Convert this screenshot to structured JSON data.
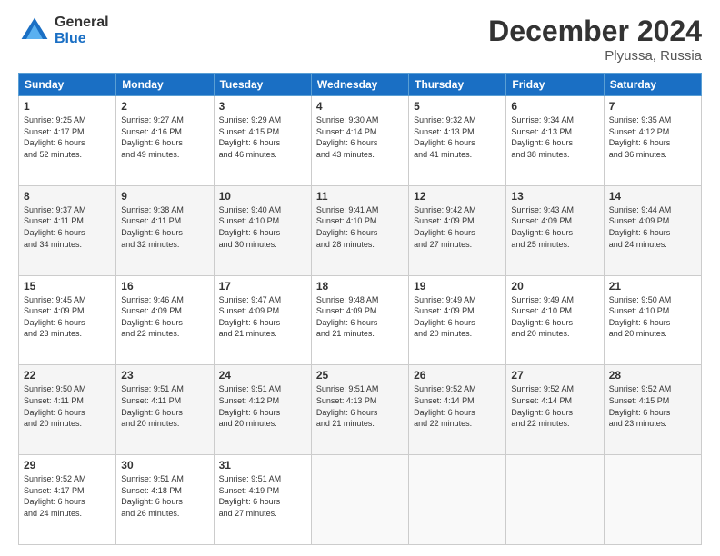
{
  "header": {
    "logo_line1": "General",
    "logo_line2": "Blue",
    "month": "December 2024",
    "location": "Plyussa, Russia"
  },
  "weekdays": [
    "Sunday",
    "Monday",
    "Tuesday",
    "Wednesday",
    "Thursday",
    "Friday",
    "Saturday"
  ],
  "weeks": [
    [
      {
        "day": "1",
        "info": "Sunrise: 9:25 AM\nSunset: 4:17 PM\nDaylight: 6 hours\nand 52 minutes."
      },
      {
        "day": "2",
        "info": "Sunrise: 9:27 AM\nSunset: 4:16 PM\nDaylight: 6 hours\nand 49 minutes."
      },
      {
        "day": "3",
        "info": "Sunrise: 9:29 AM\nSunset: 4:15 PM\nDaylight: 6 hours\nand 46 minutes."
      },
      {
        "day": "4",
        "info": "Sunrise: 9:30 AM\nSunset: 4:14 PM\nDaylight: 6 hours\nand 43 minutes."
      },
      {
        "day": "5",
        "info": "Sunrise: 9:32 AM\nSunset: 4:13 PM\nDaylight: 6 hours\nand 41 minutes."
      },
      {
        "day": "6",
        "info": "Sunrise: 9:34 AM\nSunset: 4:13 PM\nDaylight: 6 hours\nand 38 minutes."
      },
      {
        "day": "7",
        "info": "Sunrise: 9:35 AM\nSunset: 4:12 PM\nDaylight: 6 hours\nand 36 minutes."
      }
    ],
    [
      {
        "day": "8",
        "info": "Sunrise: 9:37 AM\nSunset: 4:11 PM\nDaylight: 6 hours\nand 34 minutes."
      },
      {
        "day": "9",
        "info": "Sunrise: 9:38 AM\nSunset: 4:11 PM\nDaylight: 6 hours\nand 32 minutes."
      },
      {
        "day": "10",
        "info": "Sunrise: 9:40 AM\nSunset: 4:10 PM\nDaylight: 6 hours\nand 30 minutes."
      },
      {
        "day": "11",
        "info": "Sunrise: 9:41 AM\nSunset: 4:10 PM\nDaylight: 6 hours\nand 28 minutes."
      },
      {
        "day": "12",
        "info": "Sunrise: 9:42 AM\nSunset: 4:09 PM\nDaylight: 6 hours\nand 27 minutes."
      },
      {
        "day": "13",
        "info": "Sunrise: 9:43 AM\nSunset: 4:09 PM\nDaylight: 6 hours\nand 25 minutes."
      },
      {
        "day": "14",
        "info": "Sunrise: 9:44 AM\nSunset: 4:09 PM\nDaylight: 6 hours\nand 24 minutes."
      }
    ],
    [
      {
        "day": "15",
        "info": "Sunrise: 9:45 AM\nSunset: 4:09 PM\nDaylight: 6 hours\nand 23 minutes."
      },
      {
        "day": "16",
        "info": "Sunrise: 9:46 AM\nSunset: 4:09 PM\nDaylight: 6 hours\nand 22 minutes."
      },
      {
        "day": "17",
        "info": "Sunrise: 9:47 AM\nSunset: 4:09 PM\nDaylight: 6 hours\nand 21 minutes."
      },
      {
        "day": "18",
        "info": "Sunrise: 9:48 AM\nSunset: 4:09 PM\nDaylight: 6 hours\nand 21 minutes."
      },
      {
        "day": "19",
        "info": "Sunrise: 9:49 AM\nSunset: 4:09 PM\nDaylight: 6 hours\nand 20 minutes."
      },
      {
        "day": "20",
        "info": "Sunrise: 9:49 AM\nSunset: 4:10 PM\nDaylight: 6 hours\nand 20 minutes."
      },
      {
        "day": "21",
        "info": "Sunrise: 9:50 AM\nSunset: 4:10 PM\nDaylight: 6 hours\nand 20 minutes."
      }
    ],
    [
      {
        "day": "22",
        "info": "Sunrise: 9:50 AM\nSunset: 4:11 PM\nDaylight: 6 hours\nand 20 minutes."
      },
      {
        "day": "23",
        "info": "Sunrise: 9:51 AM\nSunset: 4:11 PM\nDaylight: 6 hours\nand 20 minutes."
      },
      {
        "day": "24",
        "info": "Sunrise: 9:51 AM\nSunset: 4:12 PM\nDaylight: 6 hours\nand 20 minutes."
      },
      {
        "day": "25",
        "info": "Sunrise: 9:51 AM\nSunset: 4:13 PM\nDaylight: 6 hours\nand 21 minutes."
      },
      {
        "day": "26",
        "info": "Sunrise: 9:52 AM\nSunset: 4:14 PM\nDaylight: 6 hours\nand 22 minutes."
      },
      {
        "day": "27",
        "info": "Sunrise: 9:52 AM\nSunset: 4:14 PM\nDaylight: 6 hours\nand 22 minutes."
      },
      {
        "day": "28",
        "info": "Sunrise: 9:52 AM\nSunset: 4:15 PM\nDaylight: 6 hours\nand 23 minutes."
      }
    ],
    [
      {
        "day": "29",
        "info": "Sunrise: 9:52 AM\nSunset: 4:17 PM\nDaylight: 6 hours\nand 24 minutes."
      },
      {
        "day": "30",
        "info": "Sunrise: 9:51 AM\nSunset: 4:18 PM\nDaylight: 6 hours\nand 26 minutes."
      },
      {
        "day": "31",
        "info": "Sunrise: 9:51 AM\nSunset: 4:19 PM\nDaylight: 6 hours\nand 27 minutes."
      },
      {
        "day": "",
        "info": ""
      },
      {
        "day": "",
        "info": ""
      },
      {
        "day": "",
        "info": ""
      },
      {
        "day": "",
        "info": ""
      }
    ]
  ]
}
